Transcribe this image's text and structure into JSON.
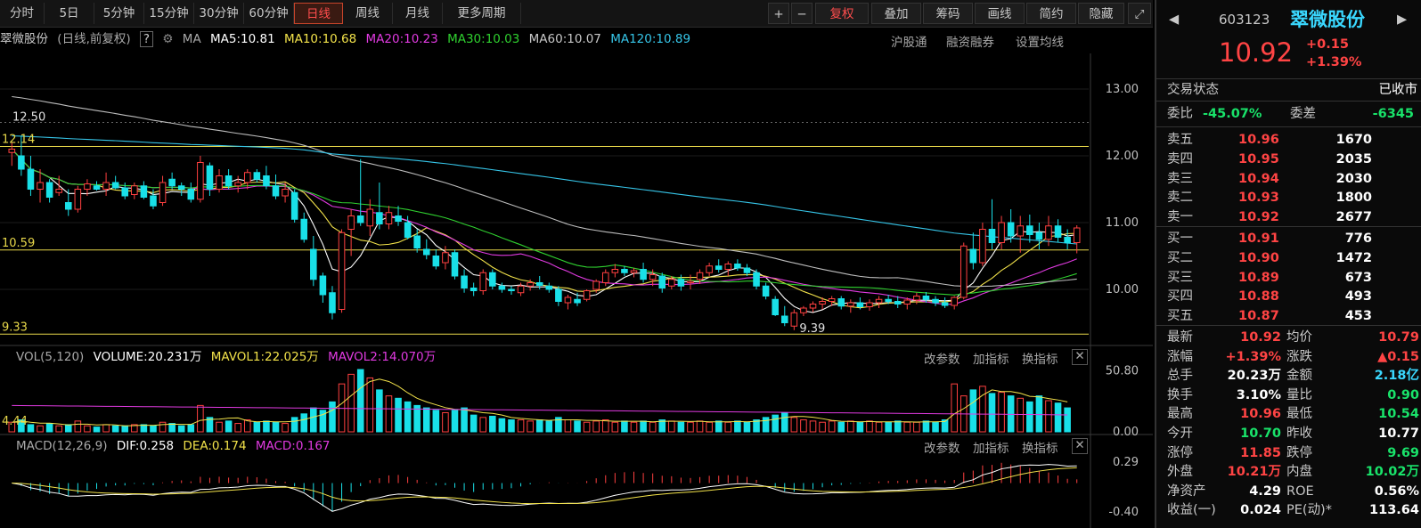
{
  "periods": [
    "分时",
    "5日",
    "5分钟",
    "15分钟",
    "30分钟",
    "60分钟",
    "日线",
    "周线",
    "月线",
    "更多周期"
  ],
  "active_period": "日线",
  "tools": {
    "plus": "+",
    "minus": "−",
    "restore": "复权",
    "overlay": "叠加",
    "chips": "筹码",
    "draw": "画线",
    "brief": "简约",
    "hide": "隐藏"
  },
  "ma_legend": {
    "name": "翠微股份",
    "mode": "(日线,前复权)",
    "help": "?",
    "ma_label": "MA",
    "ma5": "MA5:10.81",
    "ma10": "MA10:10.68",
    "ma20": "MA20:10.23",
    "ma30": "MA30:10.03",
    "ma60": "MA60:10.07",
    "ma120": "MA120:10.89",
    "link1": "沪股通",
    "link2": "融资融券",
    "link3": "设置均线"
  },
  "vol_legend": {
    "name": "VOL(5,120)",
    "volume": "VOLUME:20.231万",
    "mavol1": "MAVOL1:22.025万",
    "mavol2": "MAVOL2:14.070万"
  },
  "macd_legend": {
    "name": "MACD(12,26,9)",
    "dif": "DIF:0.258",
    "dea": "DEA:0.174",
    "macd": "MACD:0.167"
  },
  "panel_controls": {
    "params": "改参数",
    "add": "加指标",
    "switch": "换指标"
  },
  "axis": {
    "price": [
      "13.00",
      "12.00",
      "11.00",
      "10.00"
    ],
    "vol": [
      "50.80",
      "0.00"
    ],
    "macd": [
      "0.29",
      "-0.40"
    ]
  },
  "chart_labels": {
    "high": "12.50",
    "hline1": "12.14",
    "hline2": "10.59",
    "hline3": "9.33",
    "low": "9.39",
    "vol_left": "4.44"
  },
  "colors": {
    "up": "#ff4040",
    "down": "#19e0e8",
    "ma5": "#ffffff",
    "ma10": "#f2e24a",
    "ma20": "#e03ae0",
    "ma30": "#2fd02f",
    "ma60": "#bdbdbd",
    "ma120": "#36c5e8"
  },
  "quote": {
    "code": "603123",
    "name": "翠微股份",
    "price": "10.92",
    "change": "+0.15",
    "pct": "+1.39%",
    "status_label": "交易状态",
    "status": "已收市",
    "weibi_label": "委比",
    "weibi": "-45.07%",
    "weicha_label": "委差",
    "weicha": "-6345",
    "asks": [
      [
        "卖五",
        "10.96",
        "1670"
      ],
      [
        "卖四",
        "10.95",
        "2035"
      ],
      [
        "卖三",
        "10.94",
        "2030"
      ],
      [
        "卖二",
        "10.93",
        "1800"
      ],
      [
        "卖一",
        "10.92",
        "2677"
      ]
    ],
    "bids": [
      [
        "买一",
        "10.91",
        "776"
      ],
      [
        "买二",
        "10.90",
        "1472"
      ],
      [
        "买三",
        "10.89",
        "673"
      ],
      [
        "买四",
        "10.88",
        "493"
      ],
      [
        "买五",
        "10.87",
        "453"
      ]
    ],
    "stats": [
      [
        "最新",
        "10.92",
        "均价",
        "10.79"
      ],
      [
        "涨幅",
        "+1.39%",
        "涨跌",
        "▲0.15"
      ],
      [
        "总手",
        "20.23万",
        "金额",
        "2.18亿"
      ],
      [
        "换手",
        "3.10%",
        "量比",
        "0.90"
      ],
      [
        "最高",
        "10.96",
        "最低",
        "10.54"
      ],
      [
        "今开",
        "10.70",
        "昨收",
        "10.77"
      ],
      [
        "涨停",
        "11.85",
        "跌停",
        "9.69"
      ],
      [
        "外盘",
        "10.21万",
        "内盘",
        "10.02万"
      ],
      [
        "净资产",
        "4.29",
        "ROE",
        "0.56%"
      ],
      [
        "收益(一)",
        "0.024",
        "PE(动)*",
        "113.64"
      ]
    ]
  },
  "chart_data": {
    "type": "candlestick",
    "price_axis": [
      9.2,
      13.4
    ],
    "horizontal_lines": [
      12.14,
      10.59,
      9.33
    ],
    "candles": [
      [
        12.05,
        12.2,
        11.85,
        12.1
      ],
      [
        12.0,
        12.3,
        11.7,
        11.8
      ],
      [
        11.8,
        12.0,
        11.4,
        11.5
      ],
      [
        11.5,
        11.8,
        11.3,
        11.6
      ],
      [
        11.6,
        11.65,
        11.3,
        11.38
      ],
      [
        11.45,
        11.7,
        11.4,
        11.5
      ],
      [
        11.3,
        11.5,
        11.1,
        11.2
      ],
      [
        11.2,
        11.55,
        11.15,
        11.5
      ],
      [
        11.5,
        11.65,
        11.4,
        11.58
      ],
      [
        11.55,
        11.62,
        11.48,
        11.5
      ],
      [
        11.5,
        11.75,
        11.4,
        11.6
      ],
      [
        11.6,
        11.7,
        11.5,
        11.52
      ],
      [
        11.52,
        11.6,
        11.35,
        11.4
      ],
      [
        11.42,
        11.6,
        11.35,
        11.55
      ],
      [
        11.55,
        11.62,
        11.35,
        11.38
      ],
      [
        11.4,
        11.5,
        11.2,
        11.25
      ],
      [
        11.3,
        11.7,
        11.25,
        11.6
      ],
      [
        11.65,
        11.75,
        11.5,
        11.55
      ],
      [
        11.55,
        11.6,
        11.4,
        11.5
      ],
      [
        11.5,
        11.6,
        11.3,
        11.35
      ],
      [
        11.35,
        12.0,
        11.3,
        11.9
      ],
      [
        11.85,
        11.9,
        11.4,
        11.5
      ],
      [
        11.5,
        11.8,
        11.45,
        11.7
      ],
      [
        11.7,
        11.8,
        11.5,
        11.55
      ],
      [
        11.55,
        11.7,
        11.45,
        11.6
      ],
      [
        11.6,
        11.8,
        11.5,
        11.75
      ],
      [
        11.75,
        11.8,
        11.6,
        11.65
      ],
      [
        11.7,
        11.85,
        11.5,
        11.55
      ],
      [
        11.55,
        11.72,
        11.35,
        11.4
      ],
      [
        11.4,
        11.6,
        11.3,
        11.5
      ],
      [
        11.45,
        11.5,
        11.0,
        11.05
      ],
      [
        11.05,
        11.15,
        10.7,
        10.75
      ],
      [
        10.6,
        10.8,
        10.05,
        10.15
      ],
      [
        10.2,
        10.25,
        9.8,
        9.92
      ],
      [
        9.95,
        10.05,
        9.55,
        9.65
      ],
      [
        9.7,
        10.9,
        9.65,
        10.85
      ],
      [
        10.9,
        11.2,
        10.5,
        11.1
      ],
      [
        11.1,
        11.95,
        10.95,
        11.0
      ],
      [
        10.95,
        11.35,
        10.8,
        11.2
      ],
      [
        11.15,
        11.6,
        10.9,
        10.98
      ],
      [
        10.98,
        11.25,
        10.9,
        11.15
      ],
      [
        11.1,
        11.25,
        10.95,
        11.02
      ],
      [
        11.0,
        11.1,
        10.75,
        10.78
      ],
      [
        10.8,
        10.9,
        10.55,
        10.62
      ],
      [
        10.6,
        10.75,
        10.45,
        10.52
      ],
      [
        10.5,
        10.6,
        10.3,
        10.35
      ],
      [
        10.4,
        10.65,
        10.3,
        10.55
      ],
      [
        10.55,
        10.6,
        10.15,
        10.2
      ],
      [
        10.2,
        10.3,
        9.95,
        10.02
      ],
      [
        10.02,
        10.1,
        9.9,
        9.98
      ],
      [
        9.98,
        10.3,
        9.92,
        10.25
      ],
      [
        10.25,
        10.3,
        10.0,
        10.05
      ],
      [
        10.05,
        10.1,
        9.95,
        10.0
      ],
      [
        10.0,
        10.05,
        9.92,
        9.98
      ],
      [
        9.95,
        10.1,
        9.9,
        10.05
      ],
      [
        10.05,
        10.15,
        9.98,
        10.1
      ],
      [
        10.1,
        10.2,
        10.0,
        10.06
      ],
      [
        10.05,
        10.1,
        9.95,
        10.0
      ],
      [
        10.0,
        10.05,
        9.75,
        9.82
      ],
      [
        9.8,
        9.92,
        9.7,
        9.88
      ],
      [
        9.85,
        9.95,
        9.75,
        9.8
      ],
      [
        9.85,
        10.0,
        9.82,
        9.98
      ],
      [
        10.0,
        10.15,
        9.95,
        10.12
      ],
      [
        10.1,
        10.3,
        10.05,
        10.25
      ],
      [
        10.25,
        10.38,
        10.18,
        10.3
      ],
      [
        10.3,
        10.35,
        10.2,
        10.25
      ],
      [
        10.25,
        10.32,
        10.18,
        10.28
      ],
      [
        10.3,
        10.4,
        10.1,
        10.15
      ],
      [
        10.15,
        10.3,
        10.05,
        10.22
      ],
      [
        10.2,
        10.25,
        9.95,
        10.02
      ],
      [
        10.05,
        10.2,
        10.0,
        10.15
      ],
      [
        10.15,
        10.22,
        9.98,
        10.05
      ],
      [
        10.1,
        10.22,
        10.0,
        10.12
      ],
      [
        10.15,
        10.3,
        10.08,
        10.25
      ],
      [
        10.25,
        10.4,
        10.2,
        10.35
      ],
      [
        10.35,
        10.45,
        10.25,
        10.3
      ],
      [
        10.3,
        10.42,
        10.2,
        10.38
      ],
      [
        10.38,
        10.45,
        10.28,
        10.32
      ],
      [
        10.32,
        10.38,
        10.2,
        10.25
      ],
      [
        10.25,
        10.3,
        10.0,
        10.05
      ],
      [
        10.05,
        10.1,
        9.85,
        9.9
      ],
      [
        9.85,
        9.9,
        9.6,
        9.62
      ],
      [
        9.6,
        9.75,
        9.45,
        9.5
      ],
      [
        9.45,
        9.7,
        9.39,
        9.65
      ],
      [
        9.65,
        9.75,
        9.6,
        9.72
      ],
      [
        9.72,
        9.82,
        9.66,
        9.78
      ],
      [
        9.78,
        9.88,
        9.7,
        9.82
      ],
      [
        9.82,
        9.9,
        9.75,
        9.86
      ],
      [
        9.86,
        9.9,
        9.7,
        9.75
      ],
      [
        9.75,
        9.85,
        9.65,
        9.8
      ],
      [
        9.8,
        9.88,
        9.7,
        9.74
      ],
      [
        9.74,
        9.85,
        9.68,
        9.8
      ],
      [
        9.8,
        9.9,
        9.72,
        9.85
      ],
      [
        9.85,
        9.92,
        9.78,
        9.82
      ],
      [
        9.82,
        9.9,
        9.72,
        9.78
      ],
      [
        9.78,
        9.88,
        9.7,
        9.84
      ],
      [
        9.84,
        9.95,
        9.78,
        9.9
      ],
      [
        9.9,
        9.96,
        9.8,
        9.85
      ],
      [
        9.85,
        9.9,
        9.75,
        9.8
      ],
      [
        9.8,
        9.88,
        9.72,
        9.76
      ],
      [
        9.76,
        9.9,
        9.7,
        9.88
      ],
      [
        9.88,
        10.7,
        9.85,
        10.65
      ],
      [
        10.6,
        10.85,
        10.3,
        10.4
      ],
      [
        10.4,
        11.0,
        10.35,
        10.9
      ],
      [
        10.9,
        11.35,
        10.6,
        10.7
      ],
      [
        10.7,
        11.1,
        10.6,
        11.0
      ],
      [
        11.0,
        11.2,
        10.7,
        10.8
      ],
      [
        10.8,
        11.1,
        10.55,
        10.95
      ],
      [
        10.95,
        11.12,
        10.7,
        10.82
      ],
      [
        10.85,
        11.0,
        10.6,
        10.75
      ],
      [
        10.75,
        11.1,
        10.65,
        10.95
      ],
      [
        10.95,
        11.05,
        10.7,
        10.78
      ],
      [
        10.78,
        10.9,
        10.6,
        10.7
      ],
      [
        10.7,
        10.96,
        10.54,
        10.92
      ]
    ],
    "volumes": [
      8,
      10,
      6,
      5,
      7,
      5,
      6,
      9,
      5,
      4,
      6,
      5,
      5,
      6,
      6,
      5,
      8,
      7,
      5,
      6,
      22,
      12,
      8,
      9,
      7,
      10,
      8,
      9,
      8,
      7,
      12,
      15,
      20,
      18,
      25,
      40,
      48,
      52,
      45,
      35,
      30,
      28,
      25,
      22,
      20,
      18,
      16,
      18,
      20,
      14,
      12,
      13,
      11,
      10,
      10,
      9,
      10,
      9,
      12,
      10,
      9,
      8,
      9,
      10,
      8,
      9,
      8,
      9,
      8,
      10,
      9,
      8,
      8,
      9,
      8,
      9,
      8,
      9,
      8,
      10,
      12,
      14,
      16,
      12,
      10,
      9,
      8,
      9,
      8,
      9,
      8,
      9,
      8,
      8,
      9,
      8,
      8,
      9,
      8,
      10,
      40,
      30,
      35,
      38,
      32,
      33,
      30,
      28,
      25,
      30,
      26,
      24,
      20
    ]
  }
}
